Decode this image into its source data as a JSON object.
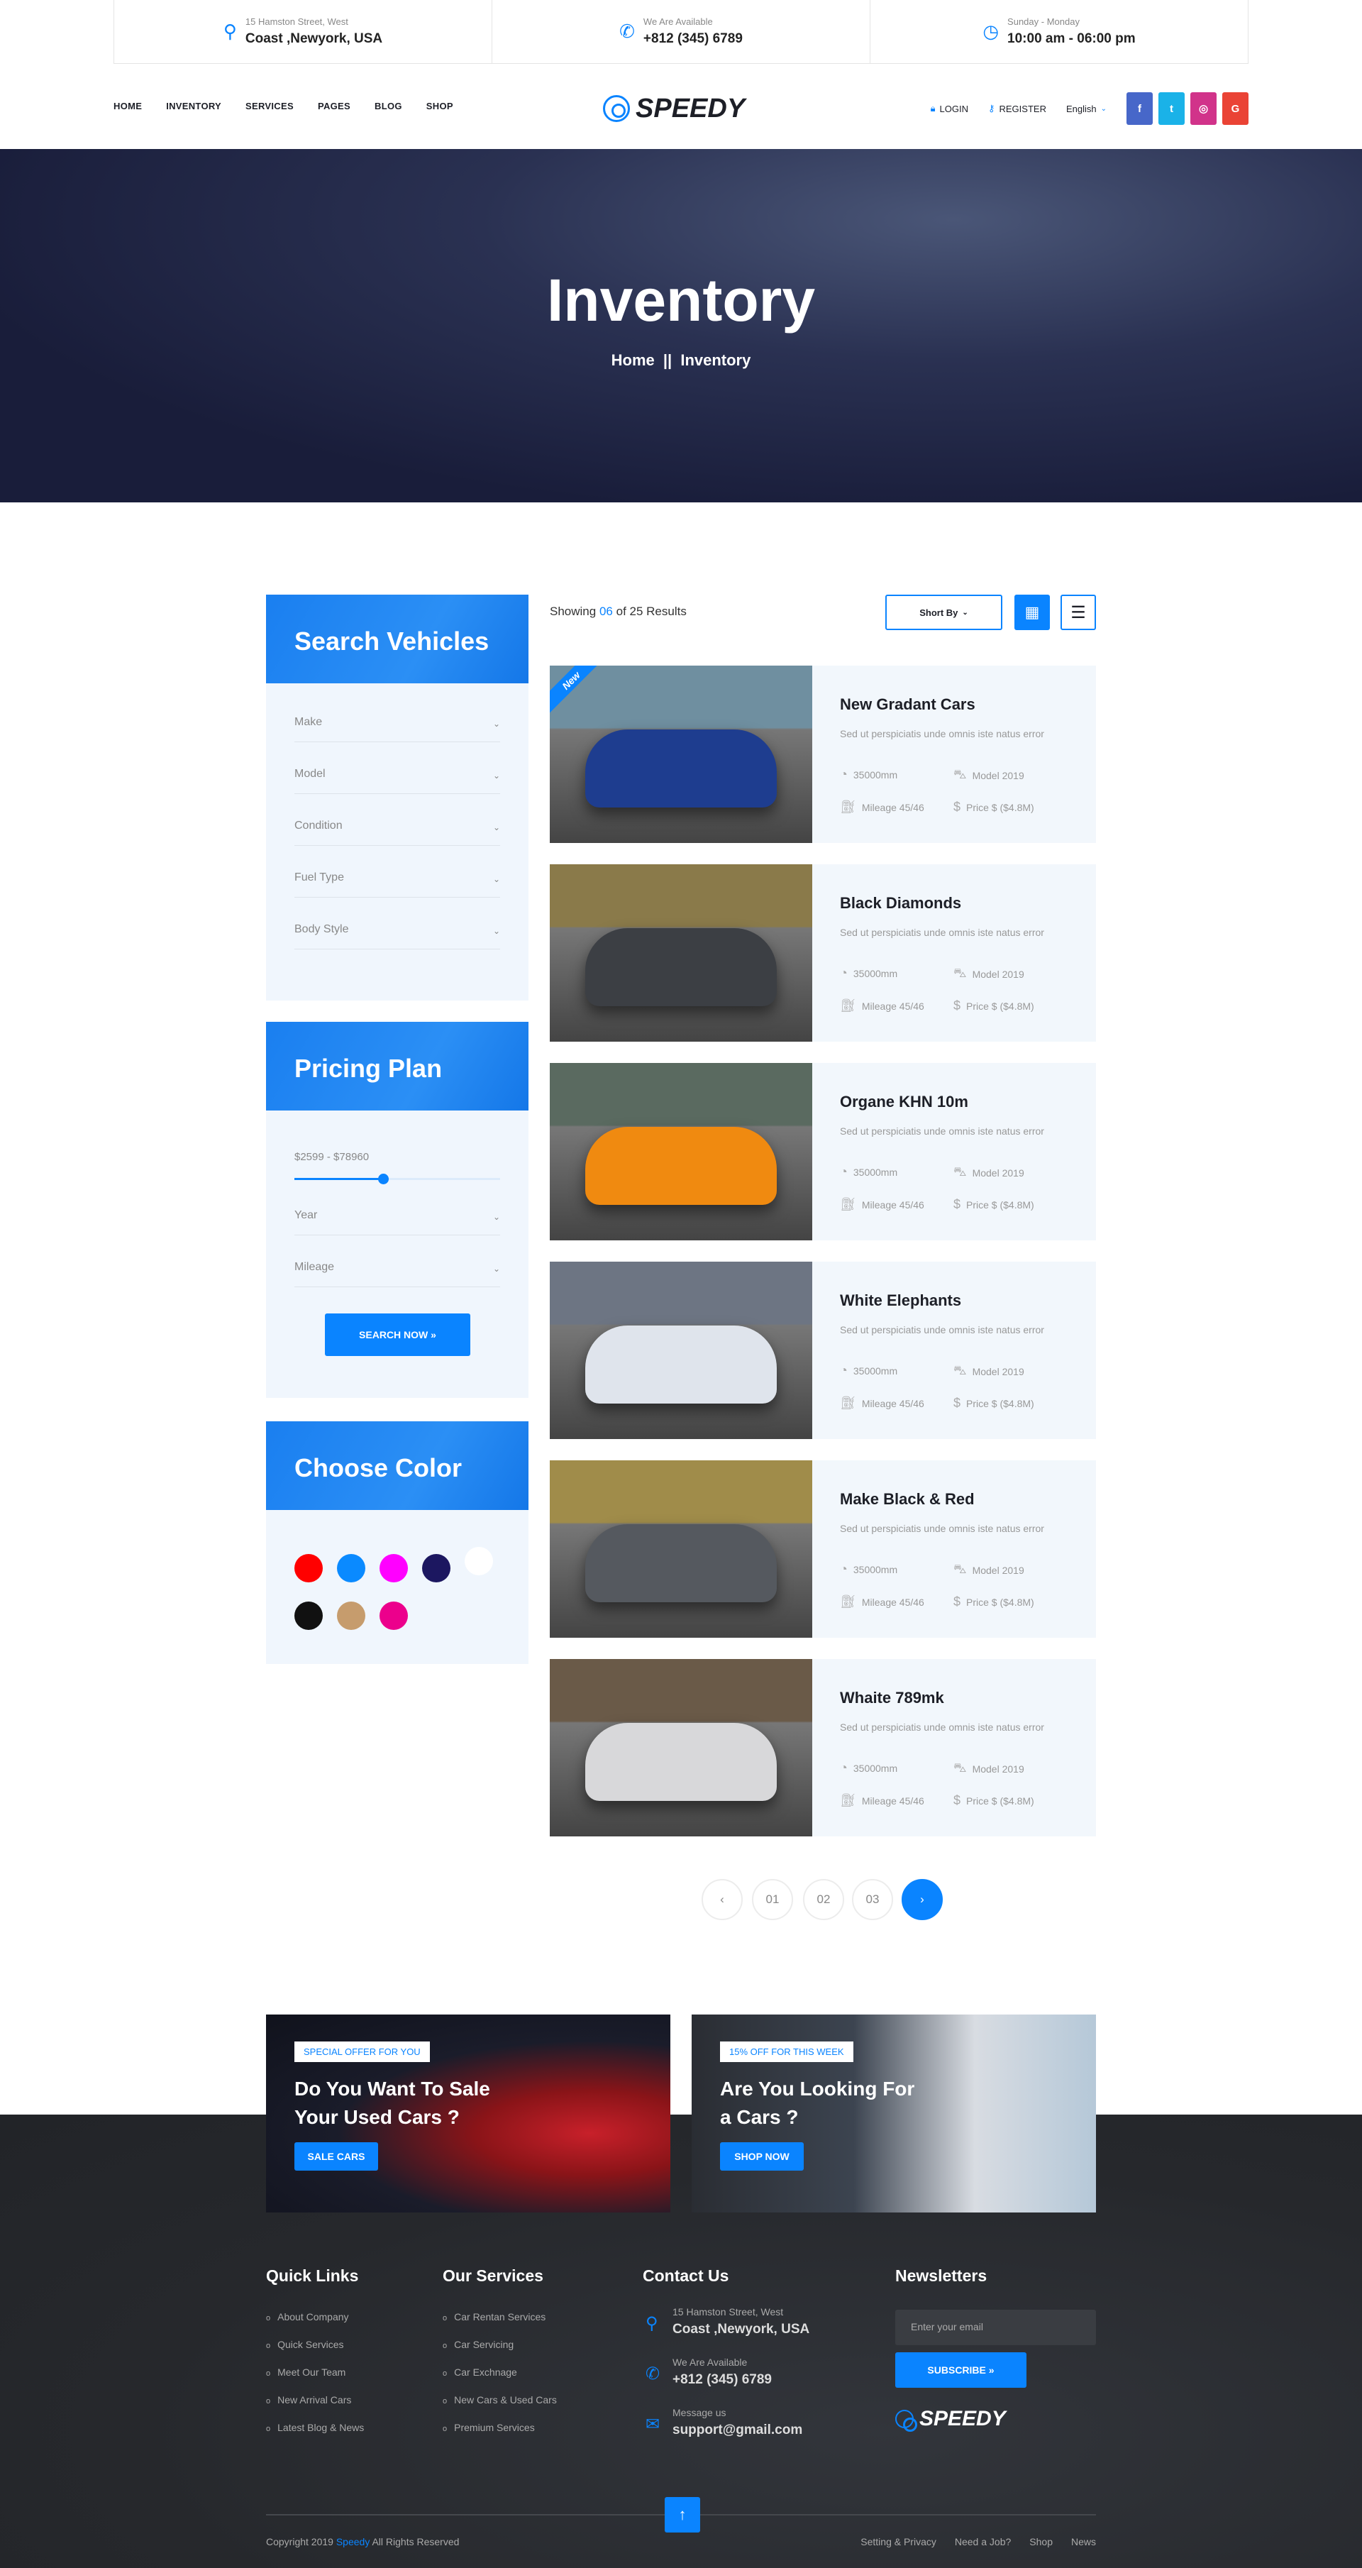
{
  "topbar": [
    {
      "icon": "map-pin-icon",
      "small": "15 Hamston Street, West",
      "big": "Coast ,Newyork, USA"
    },
    {
      "icon": "phone-icon",
      "small": "We Are Available",
      "big": "+812 (345) 6789"
    },
    {
      "icon": "clock-icon",
      "small": "Sunday - Monday",
      "big": "10:00 am - 06:00 pm"
    }
  ],
  "nav": {
    "menu": [
      "HOME",
      "INVENTORY",
      "SERVICES",
      "PAGES",
      "BLOG",
      "SHOP"
    ],
    "logo": "SPEEDY",
    "login": "LOGIN",
    "register": "REGISTER",
    "language": "English",
    "social": [
      {
        "name": "facebook",
        "label": "f",
        "color": "#4767c9"
      },
      {
        "name": "twitter",
        "label": "t",
        "color": "#1ab2e8"
      },
      {
        "name": "instagram",
        "label": "◎",
        "color": "#d1338a"
      },
      {
        "name": "google",
        "label": "G",
        "color": "#ea4335"
      }
    ]
  },
  "hero": {
    "title": "Inventory",
    "breadcrumb": [
      "Home",
      "Inventory"
    ],
    "separator": "||"
  },
  "search": {
    "title": "Search Vehicles",
    "fields": [
      "Make",
      "Model",
      "Condition",
      "Fuel Type",
      "Body Style"
    ]
  },
  "pricing": {
    "title": "Pricing Plan",
    "range": "$2599 - $78960",
    "slider_fraction": 0.43,
    "fields": [
      "Year",
      "Mileage"
    ],
    "button": "SEARCH NOW »"
  },
  "colors": {
    "title": "Choose Color",
    "swatches": [
      "#ff0000",
      "#0a8aff",
      "#ff00ff",
      "#1c1760",
      "#ffffff",
      "#111111",
      "#c69c6d",
      "#ec008c"
    ]
  },
  "results": {
    "prefix": "Showing",
    "count": "06",
    "suffix": "of 25 Results",
    "sort": "Short By"
  },
  "cars": [
    {
      "title": "New Gradant Cars",
      "badge": "New",
      "desc": "Sed ut perspiciatis unde omnis iste natus error",
      "distance": "35000mm",
      "model": "Model 2019",
      "mileage": "Mileage 45/46",
      "price": "Price $ ($4.8M)",
      "c1": "#1e3d8f",
      "c2": "#6f8fa0"
    },
    {
      "title": "Black Diamonds",
      "desc": "Sed ut perspiciatis unde omnis iste natus error",
      "distance": "35000mm",
      "model": "Model 2019",
      "mileage": "Mileage 45/46",
      "price": "Price $ ($4.8M)",
      "c1": "#3c3f44",
      "c2": "#8a7a4a"
    },
    {
      "title": "Organe KHN 10m",
      "desc": "Sed ut perspiciatis unde omnis iste natus error",
      "distance": "35000mm",
      "model": "Model 2019",
      "mileage": "Mileage 45/46",
      "price": "Price $ ($4.8M)",
      "c1": "#f08a10",
      "c2": "#5a6a60"
    },
    {
      "title": "White Elephants",
      "desc": "Sed ut perspiciatis unde omnis iste natus error",
      "distance": "35000mm",
      "model": "Model 2019",
      "mileage": "Mileage 45/46",
      "price": "Price $ ($4.8M)",
      "c1": "#dfe4ec",
      "c2": "#6d7583"
    },
    {
      "title": "Make Black & Red",
      "desc": "Sed ut perspiciatis unde omnis iste natus error",
      "distance": "35000mm",
      "model": "Model 2019",
      "mileage": "Mileage 45/46",
      "price": "Price $ ($4.8M)",
      "c1": "#55595f",
      "c2": "#a08c4a"
    },
    {
      "title": "Whaite 789mk",
      "desc": "Sed ut perspiciatis unde omnis iste natus error",
      "distance": "35000mm",
      "model": "Model 2019",
      "mileage": "Mileage 45/46",
      "price": "Price $ ($4.8M)",
      "c1": "#d8d8da",
      "c2": "#6a5a48"
    }
  ],
  "pagination": {
    "prev": "‹",
    "pages": [
      "01",
      "02",
      "03"
    ],
    "next": "›"
  },
  "banners": [
    {
      "tag": "SPECIAL OFFER FOR YOU",
      "title": "Do You Want To Sale Your Used Cars ?",
      "button": "SALE CARS"
    },
    {
      "tag": "15% OFF FOR THIS WEEK",
      "title": "Are You Looking For a Cars ?",
      "button": "SHOP NOW"
    }
  ],
  "footer": {
    "quick_title": "Quick Links",
    "quick": [
      "About Company",
      "Quick Services",
      "Meet Our Team",
      "New Arrival Cars",
      "Latest Blog & News"
    ],
    "services_title": "Our Services",
    "services": [
      "Car Rentan Services",
      "Car Servicing",
      "Car Exchnage",
      "New Cars & Used Cars",
      "Premium Services"
    ],
    "contact_title": "Contact Us",
    "contact": [
      {
        "small": "15 Hamston Street, West",
        "big": "Coast ,Newyork, USA"
      },
      {
        "small": "We Are Available",
        "big": "+812 (345) 6789"
      },
      {
        "small": "Message us",
        "big": "support@gmail.com"
      }
    ],
    "news_title": "Newsletters",
    "email_placeholder": "Enter your email",
    "subscribe": "SUBSCRIBE »",
    "logo": "SPEEDY",
    "copyright_pre": "Copyright  2019",
    "copyright_brand": "Speedy",
    "copyright_post": "All Rights Reserved",
    "links": [
      "Setting & Privacy",
      "Need a Job?",
      "Shop",
      "News"
    ],
    "to_top": "↑"
  },
  "accent": "#0a84ff"
}
